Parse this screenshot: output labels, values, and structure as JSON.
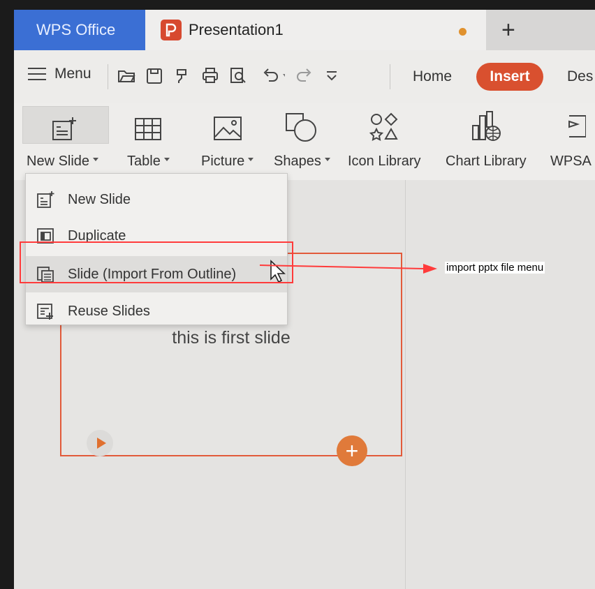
{
  "titlebar": {
    "app_tab": "WPS Office",
    "doc_tab": "Presentation1",
    "new_tab": "+"
  },
  "quickbar": {
    "menu_label": "Menu",
    "tabs": [
      "Home",
      "Insert",
      "Des"
    ],
    "active_tab": "Insert",
    "accent_color": "#d9502f"
  },
  "ribbon": {
    "buttons": [
      {
        "label": "New Slide",
        "has_dropdown": true
      },
      {
        "label": "Table",
        "has_dropdown": true
      },
      {
        "label": "Picture",
        "has_dropdown": true
      },
      {
        "label": "Shapes",
        "has_dropdown": true
      },
      {
        "label": "Icon Library",
        "has_dropdown": false
      },
      {
        "label": "Chart Library",
        "has_dropdown": false
      },
      {
        "label": "WPSA",
        "has_dropdown": false
      }
    ]
  },
  "dropdown": {
    "items": [
      {
        "label": "New Slide",
        "icon": "new-slide-icon"
      },
      {
        "label": "Duplicate",
        "icon": "duplicate-icon"
      },
      {
        "label": "Slide (Import From Outline)",
        "icon": "import-outline-icon",
        "highlighted": true
      },
      {
        "label": "Reuse Slides",
        "icon": "reuse-slides-icon"
      }
    ]
  },
  "slide": {
    "text": "this is first slide",
    "add_label": "+"
  },
  "annotation": {
    "text": "import pptx file menu",
    "color": "#ff3b3b"
  }
}
